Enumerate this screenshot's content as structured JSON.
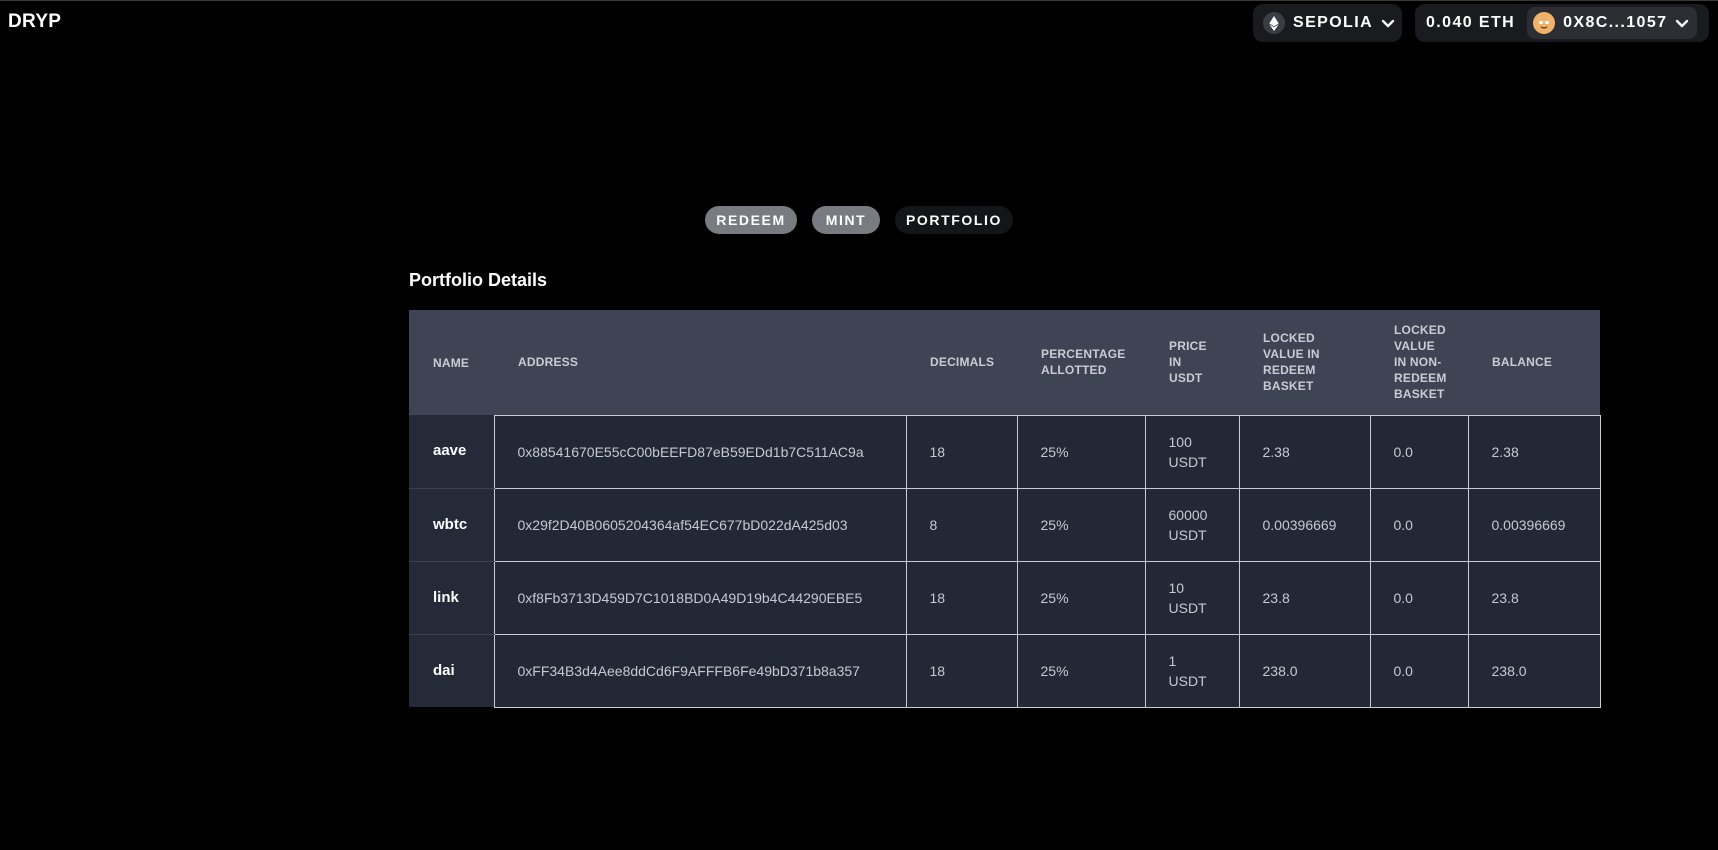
{
  "app": {
    "logo": "DRYP"
  },
  "header": {
    "network": {
      "label": "SEPOLIA",
      "icon": "ethereum-icon"
    },
    "wallet": {
      "balance": "0.040 ETH",
      "account": "0X8C...1057",
      "avatar": "avatar-icon"
    }
  },
  "tabs": [
    {
      "label": "REDEEM",
      "active": false
    },
    {
      "label": "MINT",
      "active": false
    },
    {
      "label": "PORTFOLIO",
      "active": true
    }
  ],
  "portfolio": {
    "title": "Portfolio Details",
    "columns": [
      "NAME",
      "ADDRESS",
      "DECIMALS",
      "PERCENTAGE ALLOTTED",
      "PRICE IN USDT",
      "LOCKED VALUE IN REDEEM BASKET",
      "LOCKED VALUE IN NON-REDEEM BASKET",
      "BALANCE"
    ],
    "rows": [
      {
        "name": "aave",
        "address": "0x88541670E55cC00bEEFD87eB59EDd1b7C511AC9a",
        "decimals": "18",
        "percentage": "25%",
        "price": "100\nUSDT",
        "locked_redeem": "2.38",
        "locked_non_redeem": "0.0",
        "balance": "2.38"
      },
      {
        "name": "wbtc",
        "address": "0x29f2D40B0605204364af54EC677bD022dA425d03",
        "decimals": "8",
        "percentage": "25%",
        "price": "60000\nUSDT",
        "locked_redeem": "0.00396669",
        "locked_non_redeem": "0.0",
        "balance": "0.00396669"
      },
      {
        "name": "link",
        "address": "0xf8Fb3713D459D7C1018BD0A49D19b4C44290EBE5",
        "decimals": "18",
        "percentage": "25%",
        "price": "10\nUSDT",
        "locked_redeem": "23.8",
        "locked_non_redeem": "0.0",
        "balance": "23.8"
      },
      {
        "name": "dai",
        "address": "0xFF34B3d4Aee8ddCd6F9AFFFB6Fe49bD371b8a357",
        "decimals": "18",
        "percentage": "25%",
        "price": "1\nUSDT",
        "locked_redeem": "238.0",
        "locked_non_redeem": "0.0",
        "balance": "238.0"
      }
    ]
  },
  "colors": {
    "background": "#000000",
    "header_row": "#3e4453",
    "body_row": "#232837",
    "tab_inactive": "#7a7b80",
    "tab_active": "#141518",
    "avatar": "#f0b26b"
  }
}
